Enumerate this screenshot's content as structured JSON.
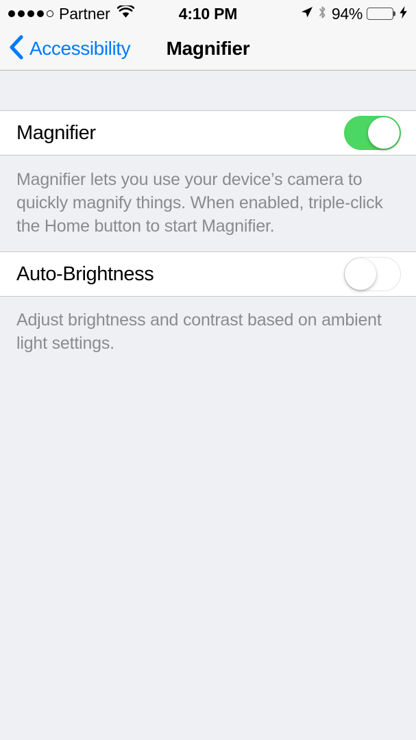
{
  "status_bar": {
    "signal_dots_filled": 4,
    "signal_dots_total": 5,
    "carrier": "Partner",
    "wifi_icon": "wifi-icon",
    "time": "4:10 PM",
    "location_icon": "location-arrow-icon",
    "bluetooth_icon": "bluetooth-icon",
    "battery_percent": "94%",
    "battery_level": 94,
    "battery_color": "#4cd662",
    "charging_icon": "lightning-bolt-icon"
  },
  "nav_bar": {
    "back_icon": "chevron-left-icon",
    "back_label": "Accessibility",
    "title": "Magnifier",
    "accent_color": "#007aff"
  },
  "sections": [
    {
      "rows": [
        {
          "label": "Magnifier",
          "control": "switch",
          "state": "on",
          "switch_name": "magnifier-switch"
        }
      ],
      "footer": "Magnifier lets you use your device’s camera to quickly magnify things. When enabled, triple-click the Home button to start Magnifier."
    },
    {
      "rows": [
        {
          "label": "Auto-Brightness",
          "control": "switch",
          "state": "off",
          "switch_name": "auto-brightness-switch"
        }
      ],
      "footer": "Adjust brightness and contrast based on ambient light settings."
    }
  ]
}
